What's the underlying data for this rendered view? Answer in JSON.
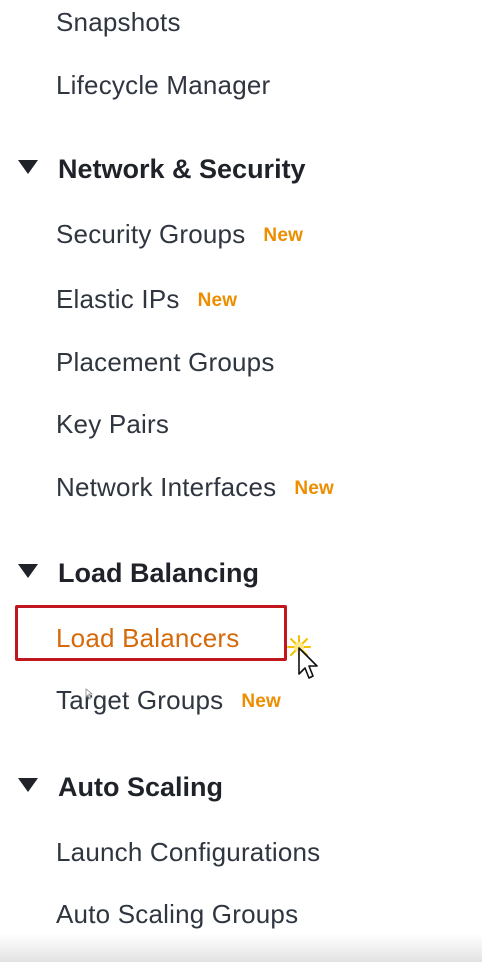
{
  "nav": {
    "top_items": [
      {
        "label": "Snapshots"
      },
      {
        "label": "Lifecycle Manager"
      }
    ],
    "sections": [
      {
        "title": "Network & Security",
        "items": [
          {
            "label": "Security Groups",
            "badge": "New"
          },
          {
            "label": "Elastic IPs",
            "badge": "New"
          },
          {
            "label": "Placement Groups"
          },
          {
            "label": "Key Pairs"
          },
          {
            "label": "Network Interfaces",
            "badge": "New"
          }
        ]
      },
      {
        "title": "Load Balancing",
        "items": [
          {
            "label": "Load Balancers",
            "active": true
          },
          {
            "label": "Target Groups",
            "badge": "New"
          }
        ]
      },
      {
        "title": "Auto Scaling",
        "items": [
          {
            "label": "Launch Configurations"
          },
          {
            "label": "Auto Scaling Groups"
          }
        ]
      }
    ]
  },
  "colors": {
    "active_link": "#d66a0b",
    "badge": "#ec8e00",
    "highlight_border": "#c0161d",
    "text": "#2f3640"
  }
}
